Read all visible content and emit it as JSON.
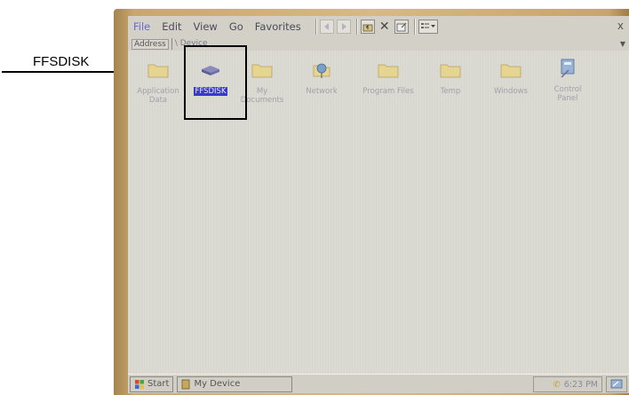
{
  "callout": {
    "label": "FFSDISK"
  },
  "menu": {
    "file": "File",
    "edit": "Edit",
    "view": "View",
    "go": "Go",
    "favorites": "Favorites"
  },
  "toolbar": {
    "back_icon": "back-arrow-icon",
    "forward_icon": "forward-arrow-icon",
    "up_icon": "folder-up-icon",
    "delete_glyph": "✕",
    "properties_icon": "properties-icon",
    "views_icon": "views-icon",
    "close_glyph": "x"
  },
  "address": {
    "label": "Address",
    "value": "\\ Device"
  },
  "icons": [
    {
      "name": "Application Data",
      "line1": "Application",
      "line2": "Data",
      "type": "folder"
    },
    {
      "name": "FFSDISK",
      "line1": "FFSDISK",
      "line2": "",
      "type": "disk",
      "selected": true
    },
    {
      "name": "My Documents",
      "line1": "My",
      "line2": "Documents",
      "type": "folder"
    },
    {
      "name": "Network",
      "line1": "Network",
      "line2": "",
      "type": "network"
    },
    {
      "name": "Program Files",
      "line1": "Program Files",
      "line2": "",
      "type": "folder"
    },
    {
      "name": "Temp",
      "line1": "Temp",
      "line2": "",
      "type": "folder"
    },
    {
      "name": "Windows",
      "line1": "Windows",
      "line2": "",
      "type": "folder"
    },
    {
      "name": "Control Panel",
      "line1": "Control",
      "line2": "Panel",
      "type": "control-panel"
    }
  ],
  "taskbar": {
    "start_label": "Start",
    "task_label": "My Device",
    "clock": "6:23 PM"
  },
  "colors": {
    "selection": "#3a3ac8",
    "folder": "#e8d48a",
    "screen_bg": "#dcdbd3"
  }
}
